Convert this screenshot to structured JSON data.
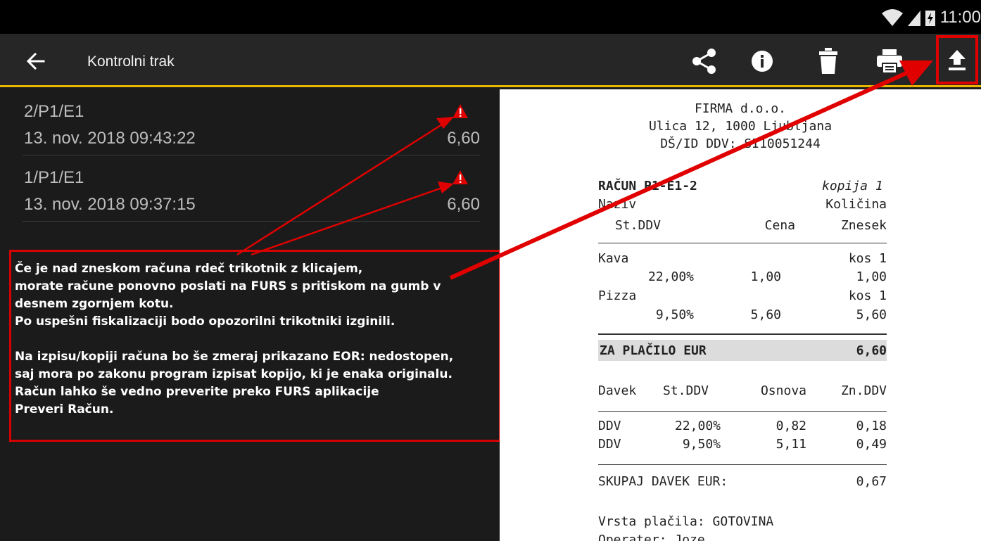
{
  "status_bar": {
    "time": "11:00"
  },
  "app_bar": {
    "title": "Kontrolni trak",
    "actions": [
      "share-icon",
      "info-icon",
      "delete-icon",
      "print-icon",
      "upload-icon"
    ]
  },
  "receipts_list": [
    {
      "id": "2/P1/E1",
      "date": "13. nov. 2018 09:43:22",
      "amount": "6,60",
      "warning": true
    },
    {
      "id": "1/P1/E1",
      "date": "13. nov. 2018 09:37:15",
      "amount": "6,60",
      "warning": true
    }
  ],
  "annotation": {
    "lines": [
      "Če je nad zneskom računa rdeč trikotnik z klicajem,",
      "morate račune ponovno poslati na FURS s pritiskom na gumb v",
      "desnem zgornjem kotu.",
      "Po uspešni fiskalizaciji bodo opozorilni trikotniki izginili.",
      "Na izpisu/kopiji računa bo še zmeraj prikazano EOR: nedostopen,",
      "saj mora po zakonu program izpisat kopijo, ki je enaka originalu.",
      "Račun lahko še vedno preverite preko FURS aplikacije",
      "Preveri Račun."
    ]
  },
  "receipt": {
    "company": "FIRMA d.o.o.",
    "address": "Ulica 12, 1000 Ljubljana",
    "tax_id": "DŠ/ID DDV: SI10051244",
    "invoice_no": "RAČUN P1-E1-2",
    "copy": "kopija 1",
    "headers": {
      "name": "Naziv",
      "qty": "Količina",
      "vat_rate": "St.DDV",
      "price": "Cena",
      "amount": "Znesek"
    },
    "items": [
      {
        "name": "Kava",
        "qty": "kos 1",
        "vat_rate": "22,00%",
        "price": "1,00",
        "amount": "1,00"
      },
      {
        "name": "Pizza",
        "qty": "kos 1",
        "vat_rate": "9,50%",
        "price": "5,60",
        "amount": "5,60"
      }
    ],
    "total_label": "ZA PLAČILO EUR",
    "total_value": "6,60",
    "tax_headers": {
      "tax": "Davek",
      "rate": "St.DDV",
      "base": "Osnova",
      "vat": "Zn.DDV"
    },
    "tax_rows": [
      {
        "tax": "DDV",
        "rate": "22,00%",
        "base": "0,82",
        "vat": "0,18"
      },
      {
        "tax": "DDV",
        "rate": "9,50%",
        "base": "5,11",
        "vat": "0,49"
      }
    ],
    "tax_total_label": "SKUPAJ DAVEK EUR:",
    "tax_total_value": "0,67",
    "payment": "Vrsta plačila: GOTOVINA",
    "operator": "Operater: Joze"
  },
  "colors": {
    "accent": "#e8b800",
    "annotation_red": "#d40000",
    "warning_red": "#e00000"
  }
}
